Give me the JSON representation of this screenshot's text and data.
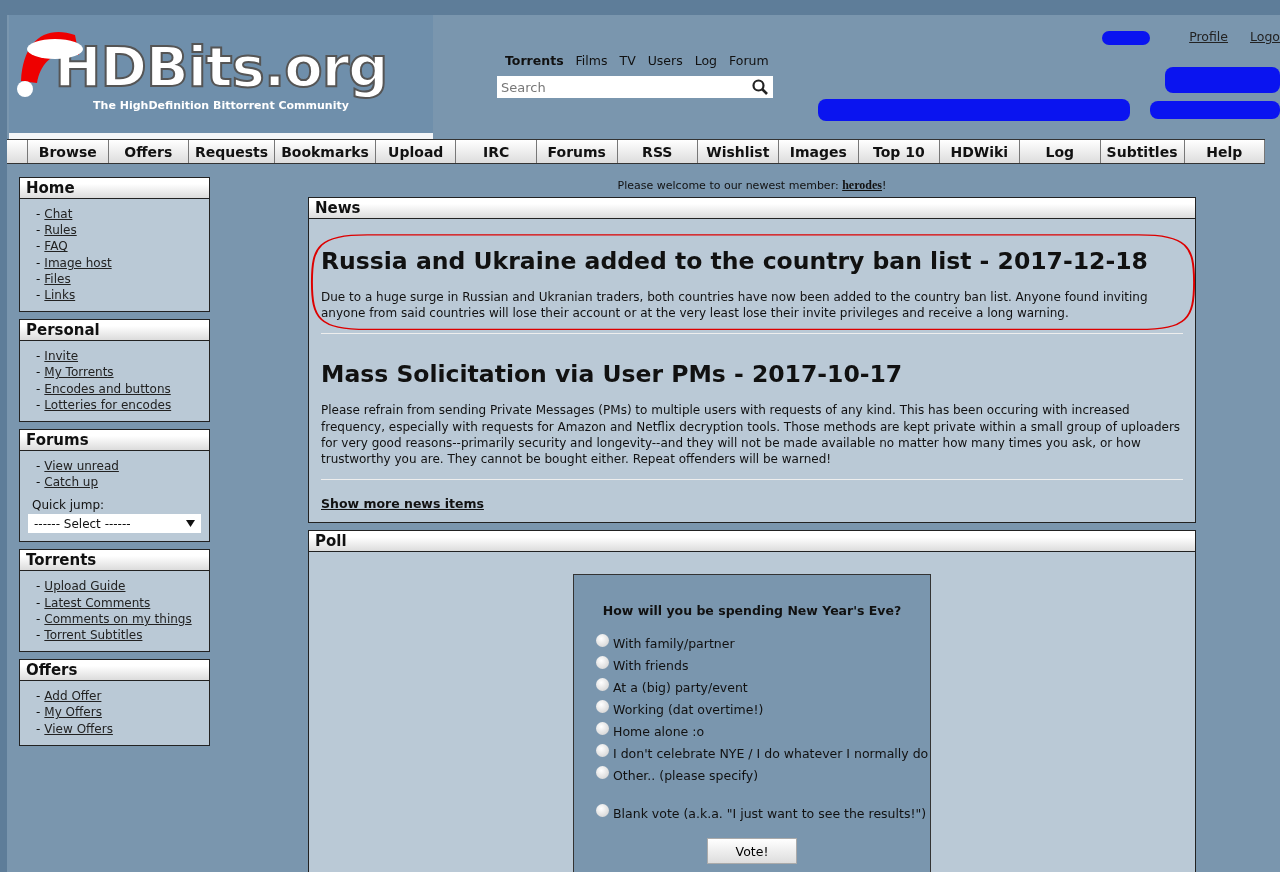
{
  "logo": {
    "title": "HDBits.org",
    "tagline": "The HighDefinition Bittorrent Community"
  },
  "top_nav": [
    {
      "label": "Torrents",
      "selected": true
    },
    {
      "label": "Films",
      "selected": false
    },
    {
      "label": "TV",
      "selected": false
    },
    {
      "label": "Users",
      "selected": false
    },
    {
      "label": "Log",
      "selected": false
    },
    {
      "label": "Forum",
      "selected": false
    }
  ],
  "search": {
    "placeholder": "Search"
  },
  "user_links": [
    "Profile",
    "Logo"
  ],
  "menu": [
    "Browse",
    "Offers",
    "Requests",
    "Bookmarks",
    "Upload",
    "IRC",
    "Forums",
    "RSS",
    "Wishlist",
    "Images",
    "Top 10",
    "HDWiki",
    "Log",
    "Subtitles",
    "Help"
  ],
  "sidebar": [
    {
      "title": "Home",
      "bullet": "-",
      "links": [
        "Chat",
        "Rules",
        "FAQ",
        "Image host",
        "Files",
        "Links"
      ]
    },
    {
      "title": "Personal",
      "bullet": "-",
      "links": [
        "Invite",
        "My Torrents",
        "Encodes and buttons",
        "Lotteries for encodes"
      ]
    },
    {
      "title": "Forums",
      "bullet": "-",
      "links": [
        "View unread",
        "Catch up"
      ],
      "quick_jump": {
        "label": "Quick jump:",
        "value": "------ Select ------"
      }
    },
    {
      "title": "Torrents",
      "bullet": "-",
      "links": [
        "Upload Guide",
        "Latest Comments",
        "Comments on my things",
        "Torrent Subtitles"
      ]
    },
    {
      "title": "Offers",
      "bullet": "-",
      "links": [
        "Add Offer",
        "My Offers",
        "View Offers"
      ]
    }
  ],
  "welcome": {
    "text": "Please welcome to our newest member: ",
    "member": "herodes",
    "suffix": "!"
  },
  "news": {
    "title": "News",
    "items": [
      {
        "headline": "Russia and Ukraine added to the country ban list - 2017-12-18",
        "body": "Due to a huge surge in Russian and Ukranian traders, both countries have now been added to the country ban list. Anyone found inviting anyone from said countries will lose their account or at the very least lose their invite privileges and receive a long warning.",
        "circled": true
      },
      {
        "headline": "Mass Solicitation via User PMs - 2017-10-17",
        "body": "Please refrain from sending Private Messages (PMs) to multiple users with requests of any kind. This has been occuring with increased frequency, especially with requests for Amazon and Netflix decryption tools. Those methods are kept private within a small group of uploaders for very good reasons--primarily security and longevity--and they will not be made available no matter how many times you ask, or how trustworthy you are. They cannot be bought either. Repeat offenders will be warned!",
        "circled": false
      }
    ],
    "more": "Show more news items"
  },
  "poll": {
    "title": "Poll",
    "question": "How will you be spending New Year's Eve?",
    "options": [
      {
        "label": "With family/partner",
        "selected": false,
        "kind": "option"
      },
      {
        "label": "With friends",
        "selected": false,
        "kind": "option"
      },
      {
        "label": "At a (big) party/event",
        "selected": false,
        "kind": "option"
      },
      {
        "label": "Working (dat overtime!)",
        "selected": false,
        "kind": "option"
      },
      {
        "label": "Home alone :o",
        "selected": false,
        "kind": "option"
      },
      {
        "label": "I don't celebrate NYE / I do whatever I normally do",
        "selected": false,
        "kind": "option"
      },
      {
        "label": "Other.. (please specify)",
        "selected": false,
        "kind": "option"
      },
      {
        "label": "Blank vote (a.k.a. \"I just want to see the results!\")",
        "selected": false,
        "kind": "blank"
      }
    ],
    "button": "Vote!"
  }
}
